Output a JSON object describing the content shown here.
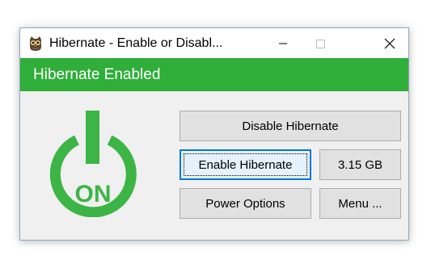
{
  "window": {
    "title": "Hibernate - Enable or Disabl...",
    "icon": "owl-app-icon",
    "controls": {
      "minimize": "minimize-icon",
      "maximize": "maximize-icon",
      "close": "close-icon"
    }
  },
  "status": {
    "text": "Hibernate Enabled",
    "color": "#2fae3a"
  },
  "logo": {
    "icon": "power-on-icon",
    "label": "ON",
    "color": "#3cb446"
  },
  "buttons": {
    "disable": "Disable Hibernate",
    "enable": "Enable Hibernate",
    "size": "3.15 GB",
    "power_options": "Power Options",
    "menu": "Menu ..."
  }
}
